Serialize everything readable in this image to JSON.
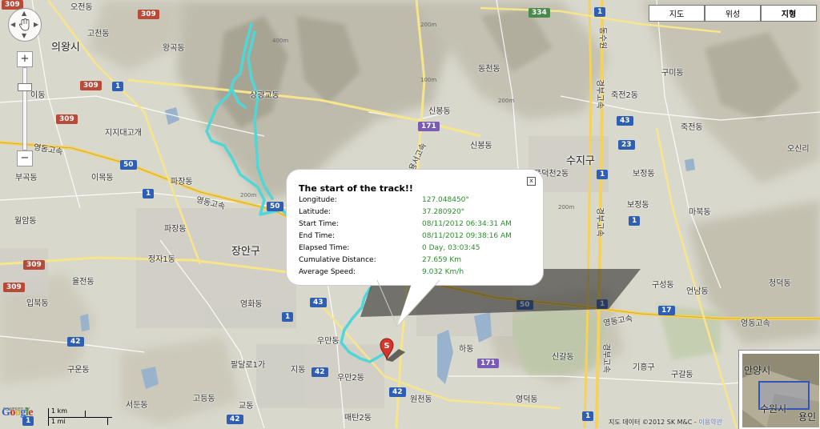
{
  "map_types": [
    {
      "label": "지도",
      "active": false
    },
    {
      "label": "위성",
      "active": false
    },
    {
      "label": "지형",
      "active": true
    }
  ],
  "nav": {
    "zoom_in": "+",
    "zoom_out": "−"
  },
  "info_window": {
    "title": "The start of the track!!",
    "close": "x",
    "rows": [
      {
        "label": "Longitude:",
        "value": "127.048450°"
      },
      {
        "label": "Latitude:",
        "value": "37.280920°"
      },
      {
        "label": "Start Time:",
        "value": "08/11/2012 06:34:31 AM"
      },
      {
        "label": "End Time:",
        "value": "08/11/2012 09:38:16 AM"
      },
      {
        "label": "Elapsed Time:",
        "value": "0 Day, 03:03:45"
      },
      {
        "label": "Cumulative Distance:",
        "value": "27.659 Km"
      },
      {
        "label": "Average Speed:",
        "value": "9.032 Km/h"
      }
    ]
  },
  "marker": {
    "label": "S",
    "color": "#d9362b"
  },
  "track_color": "#4fd6d6",
  "cities": [
    "의왕시",
    "장안구",
    "수지구"
  ],
  "places": [
    "오전동",
    "고천동",
    "왕곡동",
    "상광교동",
    "동천동",
    "구미동",
    "죽전2동",
    "신봉동",
    "신봉동",
    "이동",
    "지지대고개",
    "영동고속",
    "이목동",
    "파장동",
    "영동고속",
    "부곡동",
    "월암동",
    "파장동",
    "정자1동",
    "율전동",
    "입북동",
    "영화동",
    "우만동",
    "구운동",
    "팔달로1가",
    "지동",
    "우만2동",
    "서둔동",
    "고등동",
    "교동",
    "원천동",
    "매탄2동",
    "하동",
    "신갈동",
    "기흥구",
    "구갈동",
    "영덕동",
    "언남동",
    "구성동",
    "청덕동",
    "마북동",
    "보정동",
    "보정동",
    "죽전동",
    "오신리",
    "풍덕천2동",
    "영동고속",
    "영동고속",
    "경부고속",
    "경부고속",
    "경부고속",
    "용서고속",
    "동수원"
  ],
  "shields": {
    "blue": [
      "1",
      "1",
      "50",
      "50",
      "1",
      "1",
      "43",
      "23",
      "1",
      "42",
      "42",
      "42",
      "50",
      "42",
      "43",
      "1",
      "1",
      "1",
      "17",
      "1"
    ],
    "red": [
      "309",
      "309",
      "309",
      "309",
      "309",
      "309"
    ],
    "green": [
      "334"
    ],
    "purple": [
      "171",
      "171"
    ]
  },
  "contours": [
    "400m",
    "200m",
    "200m",
    "200m",
    "200m",
    "100m"
  ],
  "overview": {
    "labels": [
      "안양시",
      "수원시",
      "용인"
    ]
  },
  "footer": {
    "powered": "POWERED BY",
    "logo_letters": [
      "G",
      "o",
      "o",
      "g",
      "l",
      "e"
    ],
    "logo_colors": [
      "#3366cc",
      "#cc3333",
      "#ddaa22",
      "#3366cc",
      "#339933",
      "#cc3333"
    ],
    "scale_km": "1 km",
    "scale_mi": "1 mi",
    "copyright": "지도 데이터 ©2012 SK M&C - ",
    "terms": "이용약관"
  }
}
